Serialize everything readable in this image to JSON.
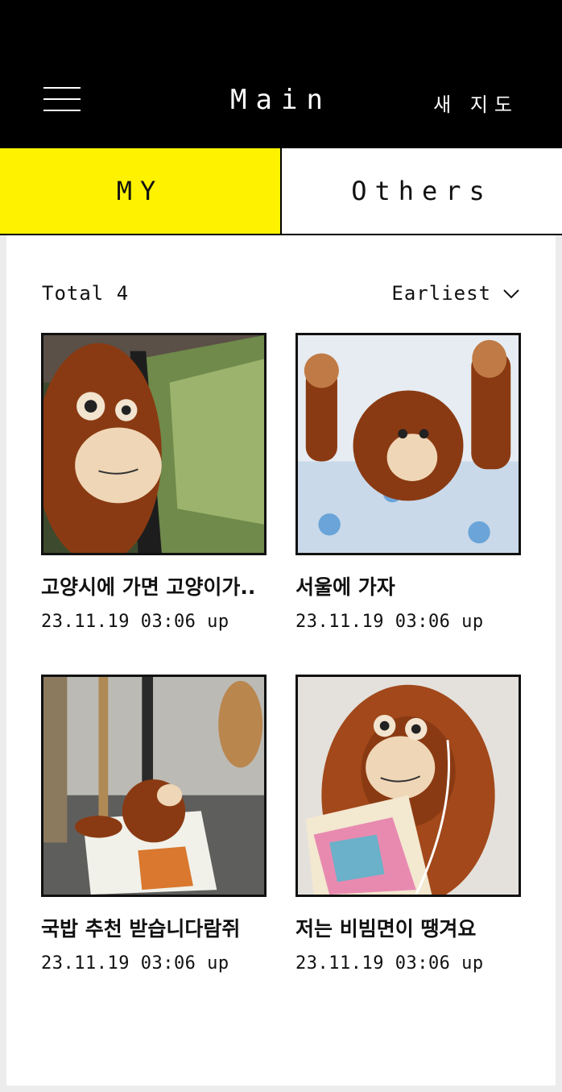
{
  "header": {
    "title": "Main",
    "right_action": "새 지도"
  },
  "tabs": [
    {
      "label": "MY",
      "active": true
    },
    {
      "label": "Others",
      "active": false
    }
  ],
  "list": {
    "total_label": "Total 4",
    "sort_label": "Earliest"
  },
  "cards": [
    {
      "title": "고양시에 가면 고양이가..",
      "date": "23.11.19 03:06 up"
    },
    {
      "title": "서울에 가자",
      "date": "23.11.19 03:06 up"
    },
    {
      "title": "국밥 추천 받습니다람쥐",
      "date": "23.11.19 03:06 up"
    },
    {
      "title": "저는 비빔면이 땡겨요",
      "date": "23.11.19 03:06 up"
    }
  ],
  "colors": {
    "accent": "#fff200",
    "header_bg": "#000000"
  }
}
